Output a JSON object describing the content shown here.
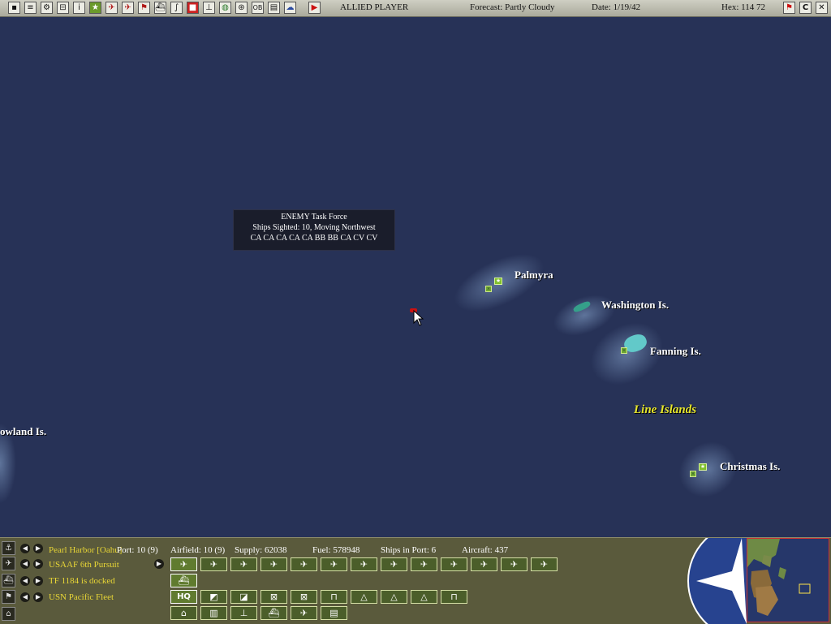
{
  "toolbar": {
    "side": "ALLIED PLAYER",
    "forecast": "Forecast: Partly Cloudy",
    "date": "Date: 1/19/42",
    "hex": "Hex: 114 72",
    "right_buttons": [
      "C"
    ]
  },
  "map": {
    "tooltip": {
      "line1": "ENEMY Task Force",
      "line2": "Ships Sighted: 10, Moving Northwest",
      "line3": "CA CA CA CA CA BB BB CA CV CV"
    },
    "islands": {
      "palmyra": "Palmyra",
      "washington": "Washington Is.",
      "fanning": "Fanning Is.",
      "christmas": "Christmas Is.",
      "howland": "owland Is."
    },
    "region": "Line Islands"
  },
  "panel": {
    "base_row": "Pearl Harbor [Oahu]",
    "stats": {
      "port": "Port: 10 (9)",
      "airfield": "Airfield: 10 (9)",
      "supply": "Supply: 62038",
      "fuel": "Fuel: 578948",
      "ships": "Ships in Port: 6",
      "aircraft": "Aircraft: 437"
    },
    "air_row": "USAAF 6th Pursuit",
    "tf_row": "TF 1184 is docked",
    "hq_row": "USN Pacific Fleet",
    "hq_button": "HQ"
  },
  "colors": {
    "ocean": "#273257",
    "panel": "#5a5a3c",
    "label_yellow": "#e8d636",
    "region_yellow": "#e6e62a"
  }
}
